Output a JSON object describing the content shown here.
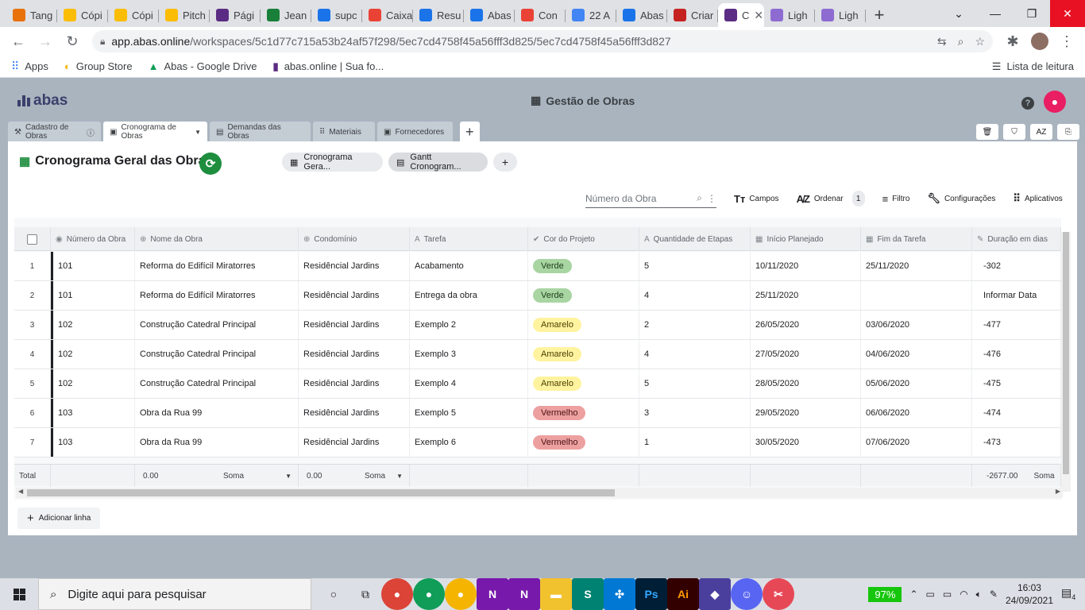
{
  "browser": {
    "tabs": [
      {
        "label": "Tang",
        "icon": "clock-icon",
        "color": "#e8710a"
      },
      {
        "label": "Cópi",
        "icon": "slides-icon",
        "color": "#fbbc04"
      },
      {
        "label": "Cópi",
        "icon": "slides-icon",
        "color": "#fbbc04"
      },
      {
        "label": "Pitch",
        "icon": "slides-icon",
        "color": "#fbbc04"
      },
      {
        "label": "Pági",
        "icon": "page-icon",
        "color": "#5b2c83"
      },
      {
        "label": "Jean",
        "icon": "flag-icon",
        "color": "#188038"
      },
      {
        "label": "supc",
        "icon": "drive-icon",
        "color": "#1a73e8"
      },
      {
        "label": "Caixa",
        "icon": "gmail-icon",
        "color": "#ea4335"
      },
      {
        "label": "Resu",
        "icon": "drive-icon",
        "color": "#1a73e8"
      },
      {
        "label": "Abas",
        "icon": "drive-icon",
        "color": "#1a73e8"
      },
      {
        "label": "Con",
        "icon": "gmail-icon",
        "color": "#ea4335"
      },
      {
        "label": "22 A",
        "icon": "docs-icon",
        "color": "#4285f4"
      },
      {
        "label": "Abas",
        "icon": "calendar-icon",
        "color": "#1a73e8"
      },
      {
        "label": "Criar",
        "icon": "sp-icon",
        "color": "#c5221f"
      },
      {
        "label": "C",
        "icon": "abas-icon",
        "color": "#5b2c83",
        "active": true
      },
      {
        "label": "Ligh",
        "icon": "feather-icon",
        "color": "#8e6bd1"
      },
      {
        "label": "Ligh",
        "icon": "feather-icon",
        "color": "#8e6bd1"
      }
    ],
    "url_host": "app.abas.online",
    "url_path": "/workspaces/5c1d77c715a53b24af57f298/5ec7cd4758f45a56fff3d825/5ec7cd4758f45a56fff3d827",
    "bookmarks": [
      {
        "label": "Apps"
      },
      {
        "label": "Group Store"
      },
      {
        "label": "Abas - Google Drive"
      },
      {
        "label": "abas.online | Sua fo..."
      }
    ],
    "reading_list": "Lista de leitura"
  },
  "app": {
    "logo_text": "abas",
    "title": "Gestão de Obras",
    "help": "?",
    "sheet_tabs": [
      {
        "label": "Cadastro de Obras"
      },
      {
        "label": "Cronograma de Obras"
      },
      {
        "label": "Demandas das Obras"
      },
      {
        "label": "Materiais"
      },
      {
        "label": "Fornecedores"
      }
    ],
    "toolbar_icons": [
      "trash-icon",
      "shield-icon",
      "sort-az-icon",
      "export-icon"
    ],
    "toolbar_az": "AZ"
  },
  "panel": {
    "title": "Cronograma Geral das Obras",
    "views": [
      "Cronograma Gera...",
      "Gantt Cronogram..."
    ],
    "search_placeholder": "Número da Obra",
    "tools": {
      "campos": "Campos",
      "ordenar": "Ordenar",
      "ordenar_count": "1",
      "filtro": "Filtro",
      "config": "Configurações",
      "apps": "Aplicativos"
    },
    "add_line": "Adicionar linha"
  },
  "grid": {
    "columns": [
      "Número da Obra",
      "Nome da Obra",
      "Condomínio",
      "Tarefa",
      "Cor do Projeto",
      "Quantidade de Etapas",
      "Início Planejado",
      "Fim da Tarefa",
      "Duração em dias"
    ],
    "rows": [
      {
        "n": "1",
        "numero": "101",
        "nome": "Reforma do Edifícil Miratorres",
        "cond": "Residêncial Jardins",
        "tarefa": "Acabamento",
        "cor": "Verde",
        "etapas": "5",
        "inicio": "10/11/2020",
        "fim": "25/11/2020",
        "duracao": "-302"
      },
      {
        "n": "2",
        "numero": "101",
        "nome": "Reforma do Edifícil Miratorres",
        "cond": "Residêncial Jardins",
        "tarefa": "Entrega da obra",
        "cor": "Verde",
        "etapas": "4",
        "inicio": "25/11/2020",
        "fim": "",
        "duracao": "Informar Data"
      },
      {
        "n": "3",
        "numero": "102",
        "nome": "Construção Catedral Principal",
        "cond": "Residêncial Jardins",
        "tarefa": "Exemplo 2",
        "cor": "Amarelo",
        "etapas": "2",
        "inicio": "26/05/2020",
        "fim": "03/06/2020",
        "duracao": "-477"
      },
      {
        "n": "4",
        "numero": "102",
        "nome": "Construção Catedral Principal",
        "cond": "Residêncial Jardins",
        "tarefa": "Exemplo 3",
        "cor": "Amarelo",
        "etapas": "4",
        "inicio": "27/05/2020",
        "fim": "04/06/2020",
        "duracao": "-476"
      },
      {
        "n": "5",
        "numero": "102",
        "nome": "Construção Catedral Principal",
        "cond": "Residêncial Jardins",
        "tarefa": "Exemplo 4",
        "cor": "Amarelo",
        "etapas": "5",
        "inicio": "28/05/2020",
        "fim": "05/06/2020",
        "duracao": "-475"
      },
      {
        "n": "6",
        "numero": "103",
        "nome": "Obra da Rua 99",
        "cond": "Residêncial Jardins",
        "tarefa": "Exemplo 5",
        "cor": "Vermelho",
        "etapas": "3",
        "inicio": "29/05/2020",
        "fim": "06/06/2020",
        "duracao": "-474"
      },
      {
        "n": "7",
        "numero": "103",
        "nome": "Obra da Rua 99",
        "cond": "Residêncial Jardins",
        "tarefa": "Exemplo 6",
        "cor": "Vermelho",
        "etapas": "1",
        "inicio": "30/05/2020",
        "fim": "07/06/2020",
        "duracao": "-473"
      }
    ],
    "pill_colors": {
      "Verde": {
        "bg": "#a8d5a2",
        "fg": "#1e3d1a"
      },
      "Amarelo": {
        "bg": "#fff3a0",
        "fg": "#4a3f00"
      },
      "Vermelho": {
        "bg": "#eda0a0",
        "fg": "#4a1212"
      }
    },
    "totals": {
      "label": "Total",
      "nome_value": "0.00",
      "nome_agg": "Soma",
      "cond_value": "0.00",
      "cond_agg": "Soma",
      "duracao_value": "-2677.00",
      "duracao_agg": "Soma"
    }
  },
  "taskbar": {
    "search_placeholder": "Digite aqui para pesquisar",
    "battery": "97%",
    "time": "16:03",
    "date": "24/09/2021",
    "notifications": "4"
  }
}
